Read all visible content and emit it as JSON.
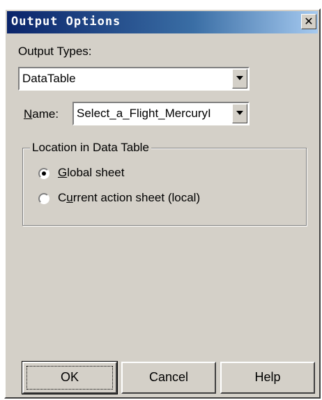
{
  "window": {
    "title": "Output Options",
    "close_glyph": "✕"
  },
  "output_types": {
    "label": "Output Types:",
    "selected": "DataTable"
  },
  "name": {
    "label_mnemonic": "N",
    "label_rest": "ame:",
    "selected": "Select_a_Flight_MercuryI"
  },
  "location": {
    "group_title": "Location in Data Table",
    "options": [
      {
        "mnemonic": "G",
        "rest": "lobal sheet",
        "checked": true
      },
      {
        "prefix": "C",
        "mnemonic": "u",
        "rest": "rrent action sheet (local)",
        "checked": false
      }
    ]
  },
  "buttons": {
    "ok": "OK",
    "cancel": "Cancel",
    "help": "Help"
  }
}
